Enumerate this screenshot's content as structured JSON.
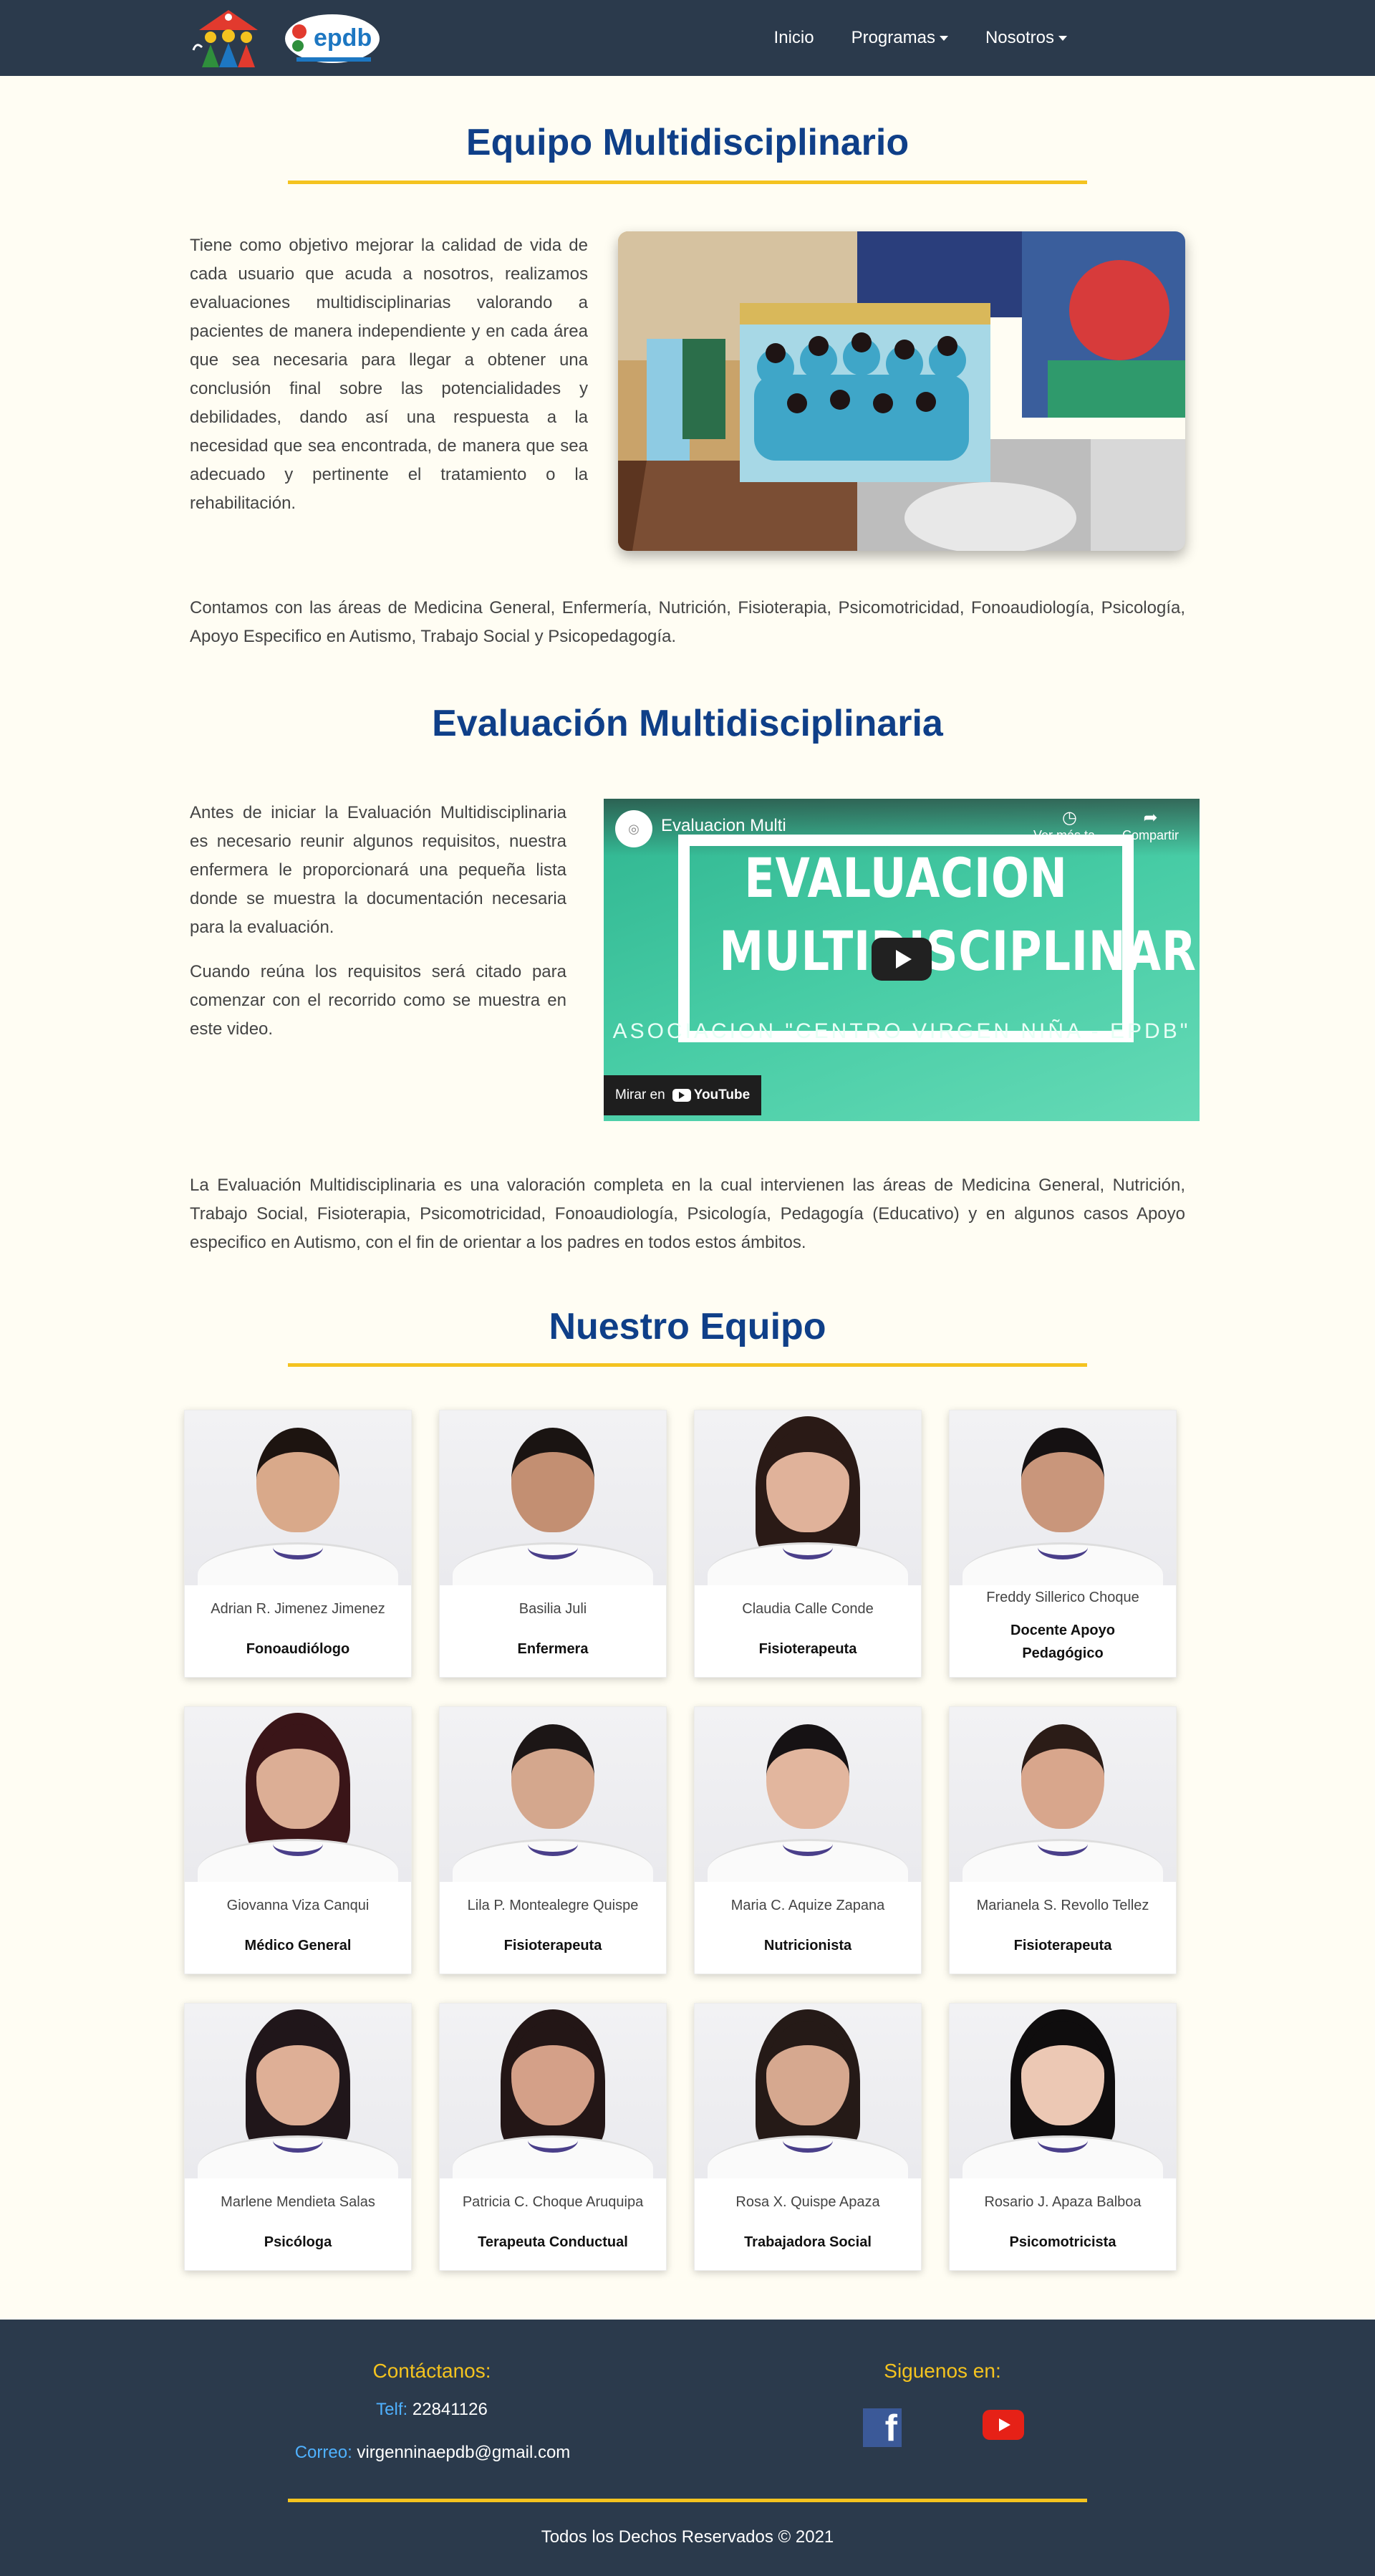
{
  "nav": {
    "items": [
      {
        "label": "Inicio"
      },
      {
        "label": "Programas"
      },
      {
        "label": "Nosotros"
      }
    ]
  },
  "section1": {
    "title": "Equipo Multidisciplinario",
    "intro": "Tiene como objetivo mejorar la calidad de vida de cada usuario que acuda a nosotros, realizamos evaluaciones multidisciplinarias valorando a pacientes de manera independiente y en cada área que sea necesaria para llegar a obtener una conclusión final sobre las potencialidades y debilidades, dando así una respuesta a la necesidad que sea encontrada, de manera que sea adecuado y pertinente el tratamiento o la rehabilitación.",
    "areas": "Contamos con las áreas de Medicina General, Enfermería, Nutrición, Fisioterapia, Psicomotricidad, Fonoaudiología, Psicología, Apoyo Especifico en Autismo, Trabajo Social y Psicopedagogía."
  },
  "section2": {
    "title": "Evaluación Multidisciplinaria",
    "p1": "Antes de iniciar la Evaluación Multidisciplinaria es necesario reunir algunos requisitos, nuestra enfermera le proporcionará una pequeña lista donde se muestra la documentación necesaria para la evaluación.",
    "p2": "Cuando reúna los requisitos será citado para comenzar con el recorrido como se muestra en este video.",
    "video": {
      "title": "Evaluacion Multi",
      "watch_later": "Ver más ta...",
      "share": "Compartir",
      "line1": "EVALUACION",
      "line2": "MULTIDISCIPLINARIA",
      "subtitle": "ASOCIACION \"CENTRO VIRGEN NIÑA - EPDB\"",
      "watch_on": "Mirar en",
      "youtube": "YouTube"
    },
    "description": "La Evaluación Multidisciplinaria es una valoración completa en la cual intervienen las áreas de Medicina General, Nutrición, Trabajo Social, Fisioterapia, Psicomotricidad, Fonoaudiología, Psicología, Pedagogía (Educativo) y en algunos casos Apoyo especifico en Autismo, con el fin de orientar a los padres en todos estos ámbitos."
  },
  "section3": {
    "title": "Nuestro Equipo",
    "team": [
      {
        "name": "Adrian R. Jimenez Jimenez",
        "role": "Fonoaudiólogo",
        "hair": "#1d1410",
        "skin": "#d9a98a",
        "long": false
      },
      {
        "name": "Basilia Juli",
        "role": "Enfermera",
        "hair": "#1a1412",
        "skin": "#c38f72",
        "long": false
      },
      {
        "name": "Claudia Calle Conde",
        "role": "Fisioterapeuta",
        "hair": "#2a1a16",
        "skin": "#e0b29a",
        "long": true
      },
      {
        "name": "Freddy Sillerico Choque",
        "role": "Docente Apoyo Pedagógico",
        "hair": "#151112",
        "skin": "#c9967b",
        "long": false
      },
      {
        "name": "Giovanna Viza Canqui",
        "role": "Médico General",
        "hair": "#3a1518",
        "skin": "#dcae95",
        "long": true
      },
      {
        "name": "Lila P. Montealegre Quispe",
        "role": "Fisioterapeuta",
        "hair": "#1c1616",
        "skin": "#d4a78d",
        "long": false
      },
      {
        "name": "Maria C. Aquize Zapana",
        "role": "Nutricionista",
        "hair": "#161214",
        "skin": "#e2b69e",
        "long": false
      },
      {
        "name": "Marianela S. Revollo Tellez",
        "role": "Fisioterapeuta",
        "hair": "#2b1c17",
        "skin": "#d8a68c",
        "long": false
      },
      {
        "name": "Marlene Mendieta Salas",
        "role": "Psicóloga",
        "hair": "#20161a",
        "skin": "#deaf96",
        "long": true
      },
      {
        "name": "Patricia C. Choque Aruquipa",
        "role": "Terapeuta Conductual",
        "hair": "#231616",
        "skin": "#d4a088",
        "long": true
      },
      {
        "name": "Rosa X. Quispe Apaza",
        "role": "Trabajadora Social",
        "hair": "#251a17",
        "skin": "#d6a88f",
        "long": true
      },
      {
        "name": "Rosario J. Apaza Balboa",
        "role": "Psicomotricista",
        "hair": "#0f0d0e",
        "skin": "#ecc8b4",
        "long": true
      }
    ]
  },
  "footer": {
    "contact_title": "Contáctanos:",
    "phone_label": "Telf:",
    "phone": "22841126",
    "email_label": "Correo:",
    "email": "virgenninaepdb@gmail.com",
    "social_title": "Siguenos en:",
    "copyright": "Todos los Dechos Reservados © 2021"
  },
  "colors": {
    "navbar": "#2b3a4c",
    "title": "#0f3f88",
    "accent": "#f4c31f",
    "background": "#fffdf3"
  }
}
